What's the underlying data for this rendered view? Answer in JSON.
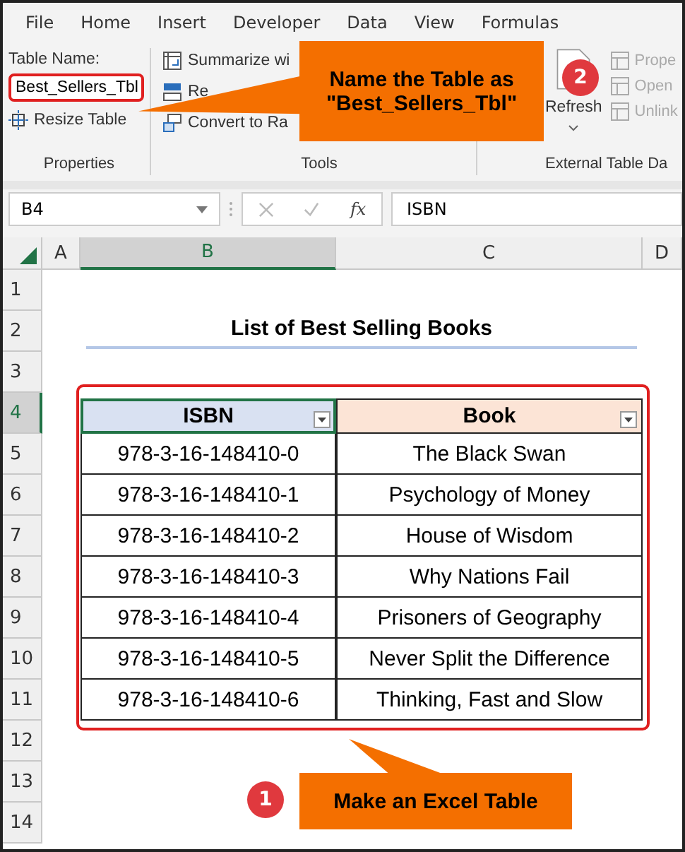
{
  "ribbon_tabs": [
    "File",
    "Home",
    "Insert",
    "Developer",
    "Data",
    "View",
    "Formulas"
  ],
  "properties_group": {
    "label": "Properties",
    "table_name_label": "Table Name:",
    "table_name_value": "Best_Sellers_Tbl",
    "resize_button": "Resize Table"
  },
  "tools_group": {
    "label": "Tools",
    "buttons": [
      {
        "label": "Summarize wi",
        "kind": "pivot"
      },
      {
        "label": "Re",
        "kind": "dupes"
      },
      {
        "label": "Convert to Ra",
        "kind": "convert"
      }
    ]
  },
  "external_group": {
    "label": "External Table Da",
    "refresh": "Refresh",
    "buttons": [
      {
        "label": "Prope",
        "disabled": true
      },
      {
        "label": "Open",
        "disabled": true
      },
      {
        "label": "Unlink",
        "disabled": true
      }
    ]
  },
  "formula_bar": {
    "name_box": "B4",
    "fx": "fx",
    "value": "ISBN"
  },
  "sheet": {
    "columns": [
      {
        "label": "A",
        "selected": false
      },
      {
        "label": "B",
        "selected": true
      },
      {
        "label": "C",
        "selected": false
      },
      {
        "label": "D",
        "selected": false
      }
    ],
    "rows": [
      {
        "label": "1",
        "selected": false
      },
      {
        "label": "2",
        "selected": false
      },
      {
        "label": "3",
        "selected": false
      },
      {
        "label": "4",
        "selected": true
      },
      {
        "label": "5",
        "selected": false
      },
      {
        "label": "6",
        "selected": false
      },
      {
        "label": "7",
        "selected": false
      },
      {
        "label": "8",
        "selected": false
      },
      {
        "label": "9",
        "selected": false
      },
      {
        "label": "10",
        "selected": false
      },
      {
        "label": "11",
        "selected": false
      },
      {
        "label": "12",
        "selected": false
      },
      {
        "label": "13",
        "selected": false
      },
      {
        "label": "14",
        "selected": false
      }
    ],
    "title": "List of Best Selling Books",
    "table": {
      "headers": [
        {
          "label": "ISBN",
          "color": "#d9e1f2",
          "selected": true
        },
        {
          "label": "Book",
          "color": "#fce4d6",
          "selected": false
        }
      ],
      "rows": [
        [
          "978-3-16-148410-0",
          "The Black Swan"
        ],
        [
          "978-3-16-148410-1",
          "Psychology of Money"
        ],
        [
          "978-3-16-148410-2",
          "House of Wisdom"
        ],
        [
          "978-3-16-148410-3",
          "Why Nations Fail"
        ],
        [
          "978-3-16-148410-4",
          "Prisoners of Geography"
        ],
        [
          "978-3-16-148410-5",
          "Never Split the Difference"
        ],
        [
          "978-3-16-148410-6",
          "Thinking, Fast and Slow"
        ]
      ]
    }
  },
  "callouts": [
    {
      "text": "Name the Table as \"Best_Sellers_Tbl\"",
      "badge": "2"
    },
    {
      "text": "Make an Excel Table",
      "badge": "1"
    }
  ]
}
